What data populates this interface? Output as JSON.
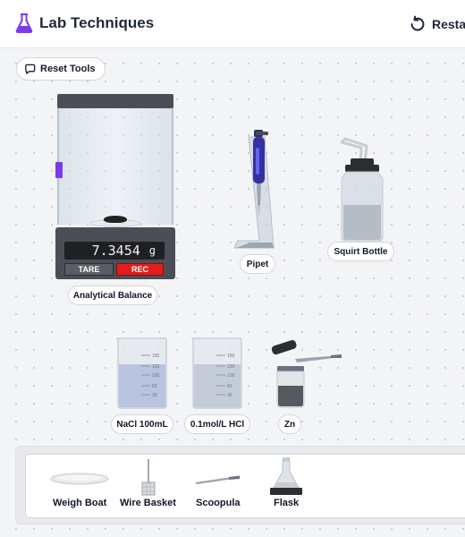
{
  "header": {
    "title": "Lab Techniques",
    "restart_label": "Restart",
    "app_icon": "flask-icon",
    "accent": "#7c3aed"
  },
  "toolbar": {
    "reset_tools_label": "Reset Tools",
    "reset_tools_icon": "chat-reset-icon"
  },
  "balance": {
    "reading": "7.3454",
    "unit": "g",
    "tare_label": "TARE",
    "rec_label": "REC",
    "name": "Analytical Balance"
  },
  "equipment": {
    "pipet": "Pipet",
    "squirt_bottle": "Squirt Bottle",
    "nacl": "NaCl 100mL",
    "hcl": "0.1mol/L HCl",
    "zn": "Zn"
  },
  "beaker_marks": [
    "150",
    "120",
    "100",
    "50",
    "30"
  ],
  "tray": {
    "items": [
      "Weigh Boat",
      "Wire Basket",
      "Scoopula",
      "Flask"
    ]
  },
  "colors": {
    "rec_button": "#e11d1d",
    "pipet_body": "#3730a3",
    "background": "#f3f4f6"
  }
}
